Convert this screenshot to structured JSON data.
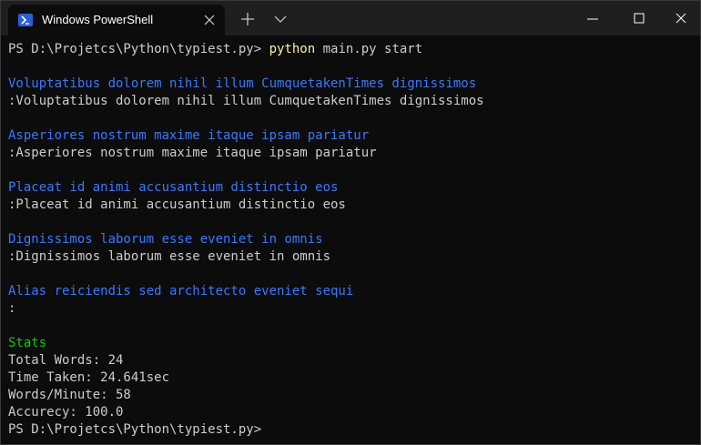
{
  "window": {
    "tab_title": "Windows PowerShell",
    "tab_icon": "powershell-icon"
  },
  "colors": {
    "background": "#0c0c0c",
    "titlebar": "#1f1f1f",
    "text": "#cccccc",
    "prompt_text": "#3b78ff",
    "stats_label": "#16c60c",
    "command": "#f9f1a5"
  },
  "terminal": {
    "prompt1": "PS D:\\Projetcs\\Python\\typiest.py> ",
    "command": "python",
    "command_args": " main.py start",
    "rounds": [
      {
        "prompt": "Voluptatibus dolorem nihil illum CumquetakenTimes dignissimos",
        "input": ":Voluptatibus dolorem nihil illum CumquetakenTimes dignissimos"
      },
      {
        "prompt": "Asperiores nostrum maxime itaque ipsam pariatur",
        "input": ":Asperiores nostrum maxime itaque ipsam pariatur"
      },
      {
        "prompt": "Placeat id animi accusantium distinctio eos",
        "input": ":Placeat id animi accusantium distinctio eos"
      },
      {
        "prompt": "Dignissimos laborum esse eveniet in omnis",
        "input": ":Dignissimos laborum esse eveniet in omnis"
      },
      {
        "prompt": "Alias reiciendis sed architecto eveniet sequi",
        "input": ":"
      }
    ],
    "stats_title": "Stats",
    "stats": [
      "Total Words: 24",
      "Time Taken: 24.641sec",
      "Words/Minute: 58",
      "Accurecy: 100.0"
    ],
    "prompt2": "PS D:\\Projetcs\\Python\\typiest.py>"
  }
}
